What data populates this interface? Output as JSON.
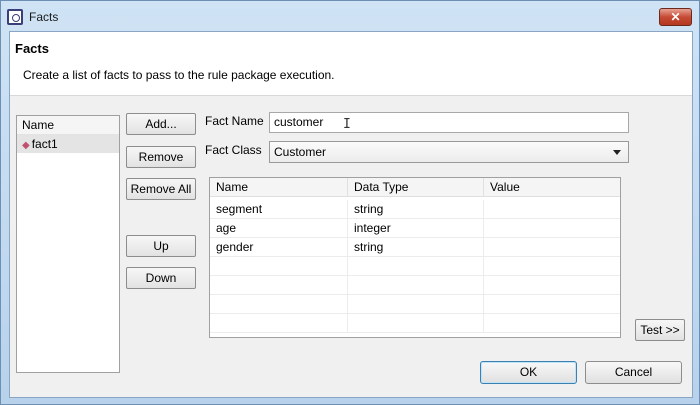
{
  "window": {
    "title": "Facts",
    "close_label": "✕"
  },
  "header": {
    "title": "Facts",
    "description": "Create a list of facts to pass to the rule package execution."
  },
  "fact_list": {
    "header": "Name",
    "items": [
      {
        "label": "fact1"
      }
    ]
  },
  "buttons": {
    "add": "Add...",
    "remove": "Remove",
    "remove_all": "Remove All",
    "up": "Up",
    "down": "Down",
    "test": "Test >>",
    "ok": "OK",
    "cancel": "Cancel"
  },
  "fact_name": {
    "label": "Fact Name",
    "value": "customer"
  },
  "fact_class": {
    "label": "Fact Class",
    "selected": "Customer"
  },
  "attributes_table": {
    "columns": [
      "Name",
      "Data Type",
      "Value"
    ],
    "rows": [
      {
        "name": "segment",
        "type": "string",
        "value": ""
      },
      {
        "name": "age",
        "type": "integer",
        "value": ""
      },
      {
        "name": "gender",
        "type": "string",
        "value": ""
      }
    ]
  }
}
